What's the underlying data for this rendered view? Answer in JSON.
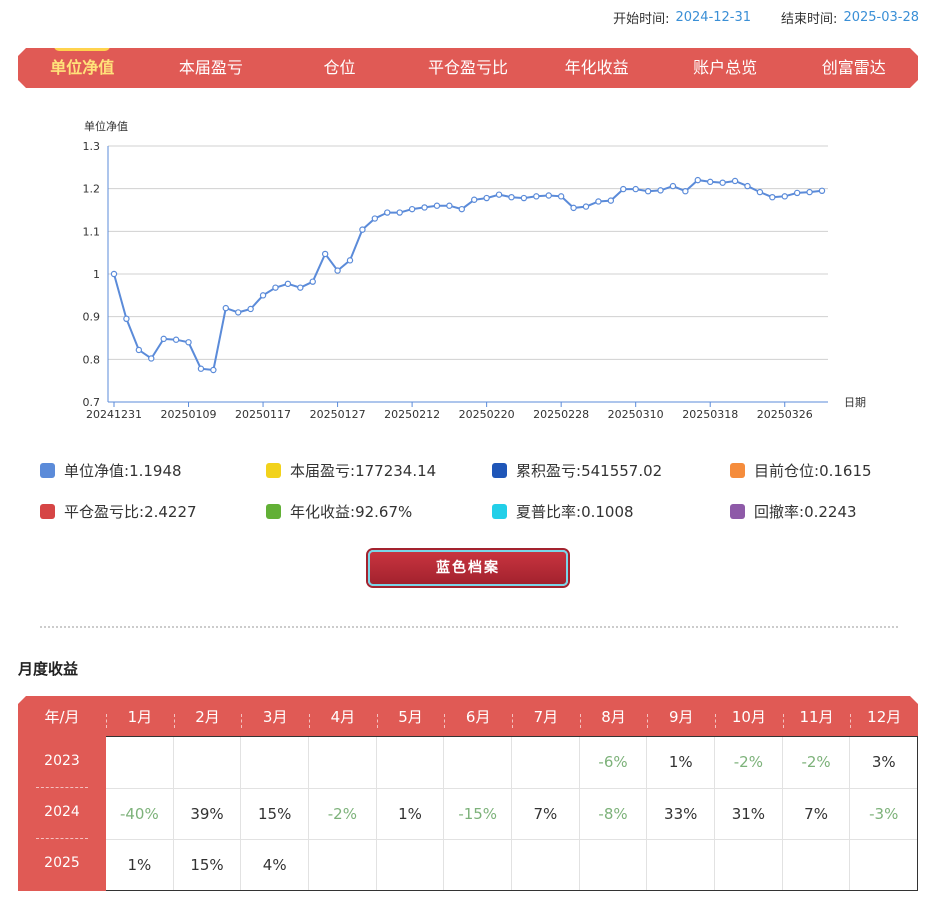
{
  "date_range": {
    "start_label": "开始时间:",
    "start_value": "2024-12-31",
    "end_label": "结束时间:",
    "end_value": "2025-03-28"
  },
  "nav": {
    "tabs": [
      "单位净值",
      "本届盈亏",
      "仓位",
      "平仓盈亏比",
      "年化收益",
      "账户总览",
      "创富雷达"
    ],
    "active_index": 0,
    "active_color": "#ffe27a",
    "bar_color": "#e05a55"
  },
  "chart_data": {
    "type": "line",
    "ylabel": "单位净值",
    "xlabel": "日期",
    "ylim": [
      0.7,
      1.3
    ],
    "yticks": [
      "0.7",
      "0.8",
      "0.9",
      "1",
      "1.1",
      "1.2",
      "1.3"
    ],
    "xtick_labels": [
      "20241231",
      "20250109",
      "20250117",
      "20250127",
      "20250212",
      "20250220",
      "20250228",
      "20250310",
      "20250318",
      "20250326"
    ],
    "xtick_indices": [
      0,
      6,
      12,
      18,
      24,
      30,
      36,
      42,
      48,
      54
    ],
    "grid": true,
    "series": [
      {
        "color": "#5b8bd9",
        "values": [
          1.0,
          0.895,
          0.822,
          0.802,
          0.848,
          0.846,
          0.84,
          0.778,
          0.775,
          0.92,
          0.91,
          0.918,
          0.95,
          0.968,
          0.977,
          0.968,
          0.982,
          1.047,
          1.008,
          1.032,
          1.104,
          1.13,
          1.144,
          1.144,
          1.152,
          1.156,
          1.16,
          1.16,
          1.152,
          1.174,
          1.178,
          1.186,
          1.18,
          1.178,
          1.182,
          1.184,
          1.182,
          1.155,
          1.158,
          1.17,
          1.172,
          1.199,
          1.199,
          1.194,
          1.196,
          1.206,
          1.194,
          1.22,
          1.216,
          1.214,
          1.218,
          1.206,
          1.192,
          1.18,
          1.182,
          1.19,
          1.192,
          1.195
        ]
      }
    ]
  },
  "stats": [
    {
      "label": "单位净值:",
      "value": "1.1948",
      "color": "#5b8bd9"
    },
    {
      "label": "本届盈亏:",
      "value": "177234.14",
      "color": "#f2d21b"
    },
    {
      "label": "累积盈亏:",
      "value": "541557.02",
      "color": "#1f56b8"
    },
    {
      "label": "目前仓位:",
      "value": "0.1615",
      "color": "#f58c3c"
    },
    {
      "label": "平仓盈亏比:",
      "value": "2.4227",
      "color": "#d64545"
    },
    {
      "label": "年化收益:",
      "value": "92.67%",
      "color": "#62b036"
    },
    {
      "label": "夏普比率:",
      "value": "0.1008",
      "color": "#22cfe8"
    },
    {
      "label": "回撤率:",
      "value": "0.2243",
      "color": "#8e5aa8"
    }
  ],
  "archive_button": "蓝色档案",
  "monthly": {
    "title": "月度收益",
    "header": [
      "年/月",
      "1月",
      "2月",
      "3月",
      "4月",
      "5月",
      "6月",
      "7月",
      "8月",
      "9月",
      "10月",
      "11月",
      "12月"
    ],
    "rows": [
      {
        "year": "2023",
        "cells": [
          "",
          "",
          "",
          "",
          "",
          "",
          "",
          "-6%",
          "1%",
          "-2%",
          "-2%",
          "3%"
        ]
      },
      {
        "year": "2024",
        "cells": [
          "-40%",
          "39%",
          "15%",
          "-2%",
          "1%",
          "-15%",
          "7%",
          "-8%",
          "33%",
          "31%",
          "7%",
          "-3%"
        ]
      },
      {
        "year": "2025",
        "cells": [
          "1%",
          "15%",
          "4%",
          "",
          "",
          "",
          "",
          "",
          "",
          "",
          "",
          ""
        ]
      }
    ],
    "negative_color": "#7db27a"
  }
}
